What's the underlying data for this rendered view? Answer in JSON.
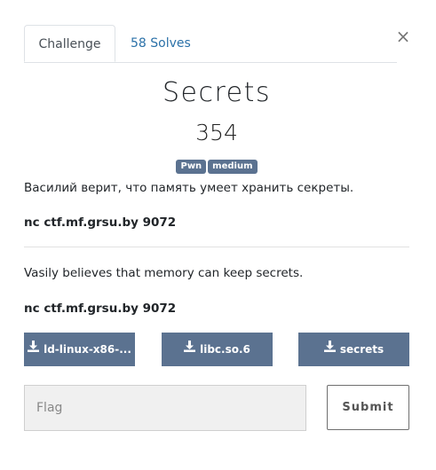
{
  "tabs": {
    "challenge_label": "Challenge",
    "solves_label": "58 Solves"
  },
  "close_glyph": "×",
  "challenge": {
    "name": "Secrets",
    "points": "354",
    "tags": [
      "Pwn",
      "medium"
    ],
    "description_ru": "Василий верит, что память умеет хранить секреты.",
    "connection_ru": "nc ctf.mf.grsu.by 9072",
    "description_en": "Vasily believes that memory can keep secrets.",
    "connection_en": "nc ctf.mf.grsu.by 9072"
  },
  "files": [
    {
      "label": "ld-linux-x86-...",
      "icon": "download-icon"
    },
    {
      "label": "libc.so.6",
      "icon": "download-icon"
    },
    {
      "label": "secrets",
      "icon": "download-icon"
    }
  ],
  "flag_form": {
    "placeholder": "Flag",
    "value": "",
    "submit_label": "Submit"
  },
  "colors": {
    "tag_bg": "#5b7290",
    "file_button_bg": "#5b7290",
    "link": "#2b71a8"
  }
}
